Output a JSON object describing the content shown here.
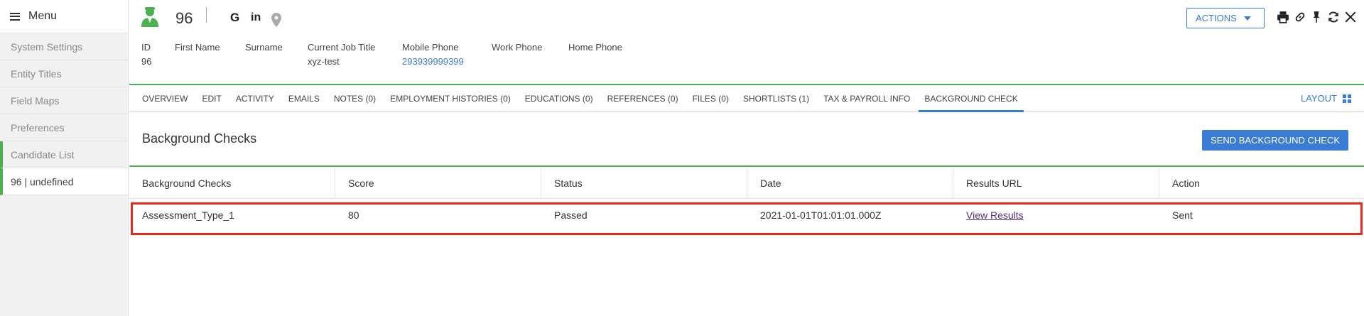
{
  "sidebar": {
    "menu_label": "Menu",
    "items": [
      {
        "label": "System Settings"
      },
      {
        "label": "Entity Titles"
      },
      {
        "label": "Field Maps"
      },
      {
        "label": "Preferences"
      },
      {
        "label": "Candidate List"
      },
      {
        "label": "96 | undefined"
      }
    ]
  },
  "header": {
    "record_id": "96",
    "actions_label": "ACTIONS",
    "fields": [
      {
        "label": "ID",
        "value": "96"
      },
      {
        "label": "First Name",
        "value": ""
      },
      {
        "label": "Surname",
        "value": ""
      },
      {
        "label": "Current Job Title",
        "value": "xyz-test"
      },
      {
        "label": "Mobile Phone",
        "value": "293939999399"
      },
      {
        "label": "Work Phone",
        "value": ""
      },
      {
        "label": "Home Phone",
        "value": ""
      }
    ],
    "social": {
      "google": "G",
      "linkedin": "in"
    }
  },
  "tabs": [
    {
      "label": "OVERVIEW"
    },
    {
      "label": "EDIT"
    },
    {
      "label": "ACTIVITY"
    },
    {
      "label": "EMAILS"
    },
    {
      "label": "NOTES (0)"
    },
    {
      "label": "EMPLOYMENT HISTORIES (0)"
    },
    {
      "label": "EDUCATIONS (0)"
    },
    {
      "label": "REFERENCES (0)"
    },
    {
      "label": "FILES (0)"
    },
    {
      "label": "SHORTLISTS (1)"
    },
    {
      "label": "TAX & PAYROLL INFO"
    },
    {
      "label": "BACKGROUND CHECK"
    }
  ],
  "layout_label": "LAYOUT",
  "section": {
    "title": "Background Checks",
    "send_button": "SEND BACKGROUND CHECK"
  },
  "table": {
    "columns": [
      "Background Checks",
      "Score",
      "Status",
      "Date",
      "Results URL",
      "Action"
    ],
    "rows": [
      {
        "check": "Assessment_Type_1",
        "score": "80",
        "status": "Passed",
        "date": "2021-01-01T01:01:01.000Z",
        "results": "View Results",
        "action": "Sent"
      }
    ]
  },
  "colors": {
    "accent": "#3a7bd5",
    "green": "#4caf50",
    "highlight": "#e8291c"
  }
}
